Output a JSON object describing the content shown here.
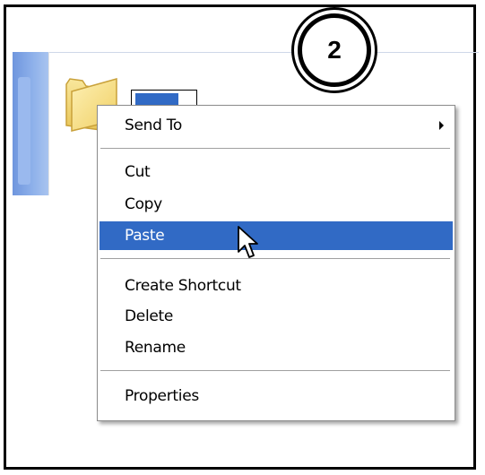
{
  "step_badge": {
    "number": "2"
  },
  "context_menu": {
    "send_to": "Send To",
    "cut": "Cut",
    "copy": "Copy",
    "paste": "Paste",
    "create_shortcut": "Create Shortcut",
    "delete": "Delete",
    "rename": "Rename",
    "properties": "Properties",
    "highlighted_item": "Paste"
  },
  "icons": {
    "folder": "folder-icon",
    "submenu_arrow": "chevron-right-icon",
    "cursor": "mouse-pointer-icon"
  },
  "colors": {
    "selection": "#316ac5",
    "side_panel": "#7aa2e3",
    "folder": "#f4d77a"
  }
}
